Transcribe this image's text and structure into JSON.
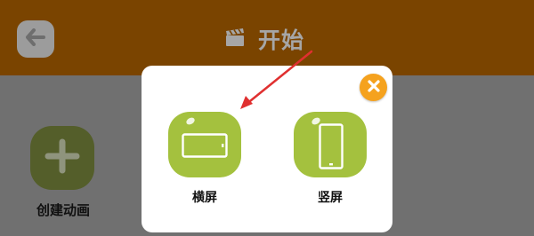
{
  "header": {
    "title": "开始",
    "back_icon": "arrow-left-icon",
    "title_icon": "clapperboard-icon"
  },
  "main": {
    "create_label": "创建动画",
    "create_icon": "plus-icon"
  },
  "dialog": {
    "close_icon": "close-icon",
    "options": [
      {
        "label": "横屏",
        "icon": "landscape-phone-icon"
      },
      {
        "label": "竖屏",
        "icon": "portrait-phone-icon"
      }
    ]
  },
  "annotation": {
    "type": "red-arrow",
    "color": "#e03030"
  },
  "colors": {
    "header": "#7a4400",
    "overlay": "#707070",
    "option_green": "#a4c13e",
    "close_orange": "#f5a21e"
  }
}
